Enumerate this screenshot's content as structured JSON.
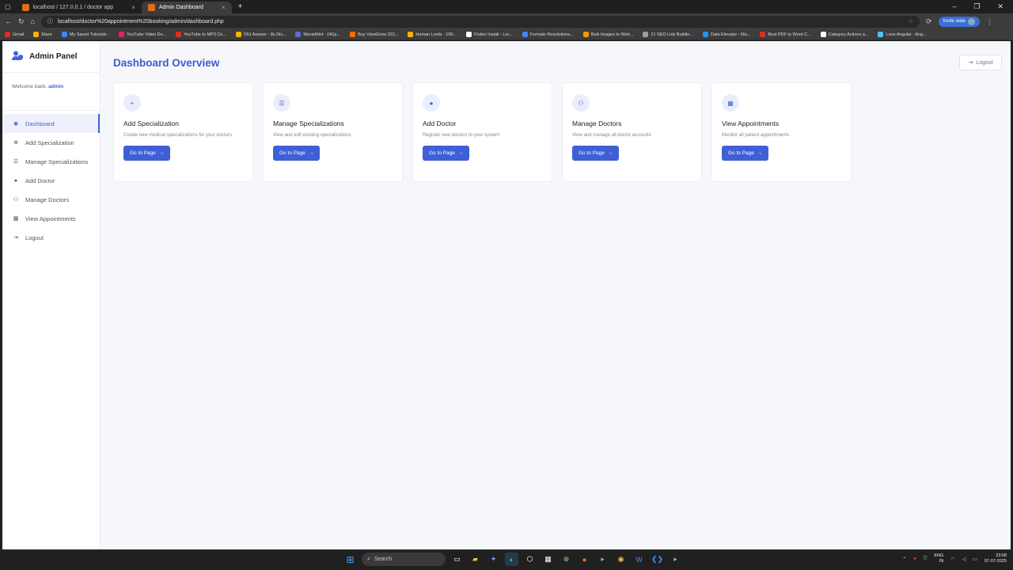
{
  "browser": {
    "tabs": [
      {
        "label": "localhost / 127.0.0.1 / doctor app",
        "close": "×",
        "active": false,
        "color": "#e36b1d"
      },
      {
        "label": "Admin Dashboard",
        "close": "×",
        "active": true,
        "color": "#e36b1d"
      }
    ],
    "new_tab": "+",
    "window_controls": {
      "minimize": "–",
      "restore": "❐",
      "close": "✕"
    },
    "url": "localhost/doctor%20appointment%20booking/admin/dashboard.php",
    "profile_label": "Invite wale",
    "bookmarks": [
      {
        "label": "Gmail",
        "color": "#d93025"
      },
      {
        "label": "Maze",
        "color": "#f4b400"
      },
      {
        "label": "My Saved Tutorials -",
        "color": "#4285f4"
      },
      {
        "label": "YouTube Video Do...",
        "color": "#e91e63"
      },
      {
        "label": "YouTube to MP3 Co...",
        "color": "#d93025"
      },
      {
        "label": "DIU Answer - 8x Div...",
        "color": "#f4b400"
      },
      {
        "label": "MovieMint - (4Gp...",
        "color": "#5f6bd9"
      },
      {
        "label": "Buy ViewGrow 222...",
        "color": "#ff6d00"
      },
      {
        "label": "Human Lords - 100...",
        "color": "#f4b400"
      },
      {
        "label": "Flutter Install - Lor...",
        "color": "#ffffff"
      },
      {
        "label": "Formats Resolutions...",
        "color": "#4285f4"
      },
      {
        "label": "Bulk Images to Web...",
        "color": "#ff9800"
      },
      {
        "label": "21 SEO Link Buildin...",
        "color": "#9e9e9e"
      },
      {
        "label": "Data Elevator - Ma...",
        "color": "#2196f3"
      },
      {
        "label": "Best PDF to Word C...",
        "color": "#d93025"
      },
      {
        "label": "Category Actions a...",
        "color": "#ffffff"
      },
      {
        "label": "Lune Angular - Ang...",
        "color": "#4fc3f7"
      }
    ]
  },
  "sidebar": {
    "brand": "Admin Panel",
    "welcome_prefix": "Welcome back,",
    "welcome_user": "admin",
    "items": [
      {
        "label": "Dashboard",
        "icon": "◉",
        "icon_name": "dashboard-icon",
        "active": true
      },
      {
        "label": "Add Specialization",
        "icon": "⊕",
        "icon_name": "plus-circle-icon",
        "active": false
      },
      {
        "label": "Manage Specializations",
        "icon": "☰",
        "icon_name": "list-icon",
        "active": false
      },
      {
        "label": "Add Doctor",
        "icon": "●",
        "icon_name": "user-icon",
        "active": false
      },
      {
        "label": "Manage Doctors",
        "icon": "⚇",
        "icon_name": "users-icon",
        "active": false
      },
      {
        "label": "View Appointments",
        "icon": "▦",
        "icon_name": "calendar-icon",
        "active": false
      },
      {
        "label": "Logout",
        "icon": "⇥",
        "icon_name": "logout-icon",
        "active": false
      }
    ]
  },
  "header": {
    "title": "Dashboard Overview",
    "logout": "Logout"
  },
  "cards": [
    {
      "title": "Add Specialization",
      "desc": "Create new medical specializations for your doctors",
      "button": "Go to Page",
      "icon": "+",
      "icon_name": "plus-circle-icon"
    },
    {
      "title": "Manage Specializations",
      "desc": "View and edit existing specializations",
      "button": "Go to Page",
      "icon": "☰",
      "icon_name": "list-icon"
    },
    {
      "title": "Add Doctor",
      "desc": "Register new doctors to your system",
      "button": "Go to Page",
      "icon": "●",
      "icon_name": "user-icon"
    },
    {
      "title": "Manage Doctors",
      "desc": "View and manage all doctor accounts",
      "button": "Go to Page",
      "icon": "⚇",
      "icon_name": "users-icon"
    },
    {
      "title": "View Appointments",
      "desc": "Monitor all patient appointments",
      "button": "Go to Page",
      "icon": "▦",
      "icon_name": "calendar-icon"
    }
  ],
  "taskbar": {
    "search": "Search",
    "lang": "ENG",
    "region": "IN",
    "time": "23:58",
    "date": "07-07-2025"
  },
  "colors": {
    "accent": "#3f5fd6",
    "title": "#3f5ccc",
    "page_bg": "#f5f7fb"
  }
}
